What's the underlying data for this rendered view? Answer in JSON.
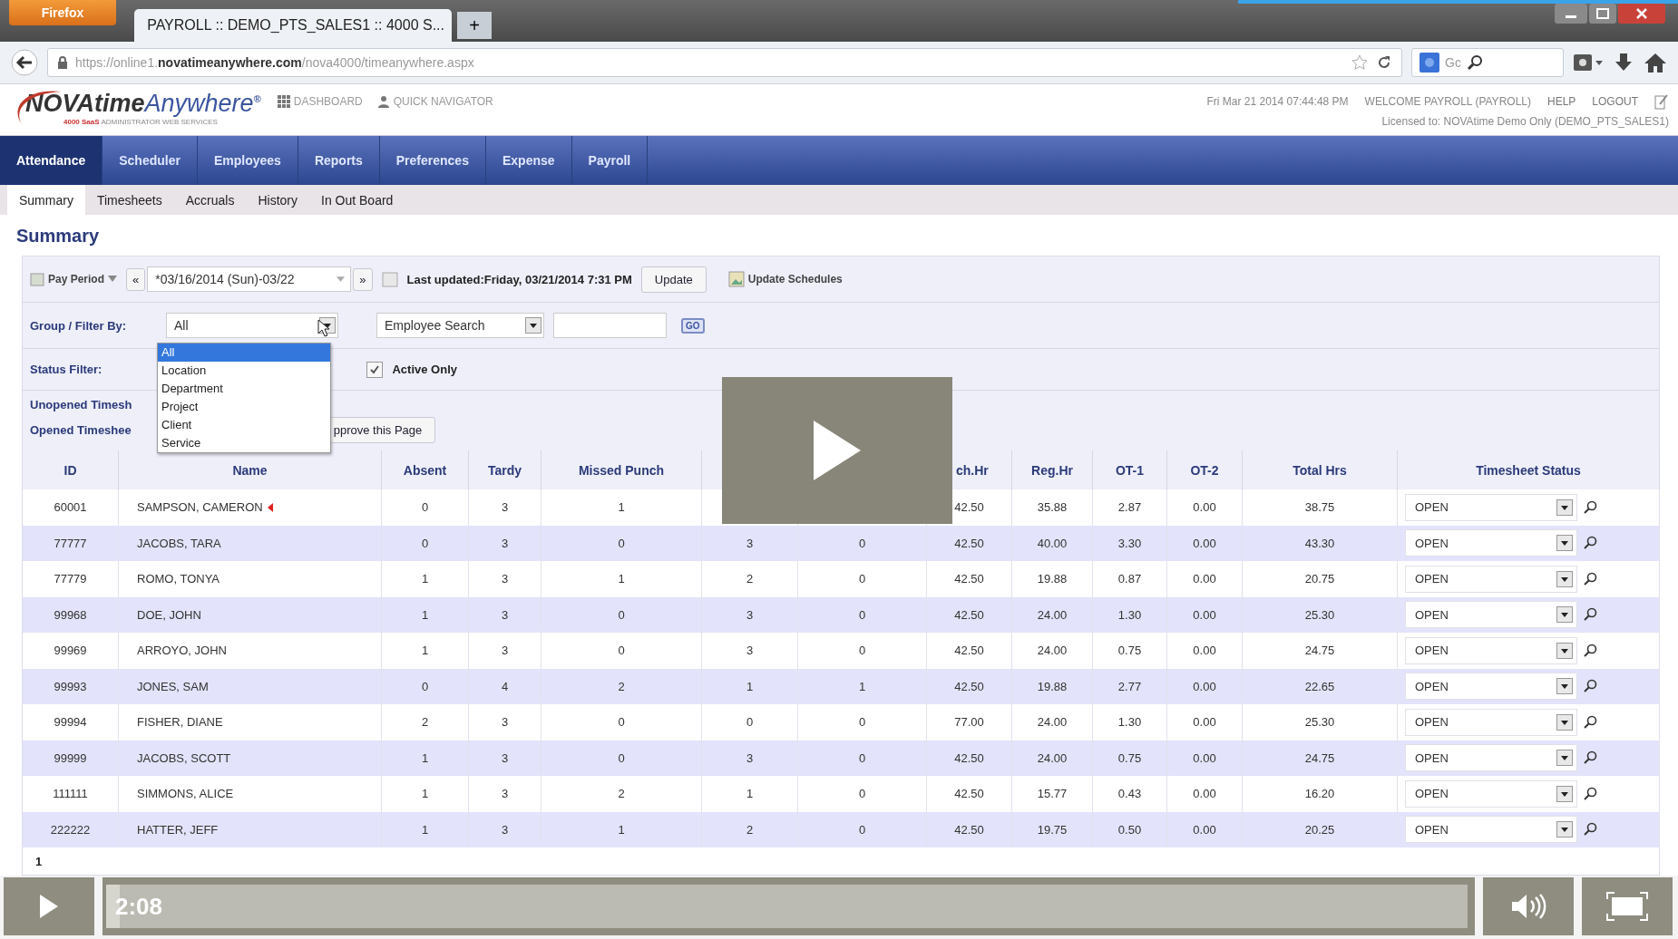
{
  "browser": {
    "menu_button": "Firefox",
    "tab_title": "PAYROLL :: DEMO_PTS_SALES1 :: 4000 S...",
    "new_tab": "+",
    "url": "https://online1.**novatimeanywhere.com**/nova4000/timeanywhere.aspx",
    "search_hint": "Gc"
  },
  "app_header": {
    "logo_main": "NOVAtime",
    "logo_accent": "Anywhere",
    "logo_mark": "®",
    "tagline_red": "4000 SaaS",
    "tagline": "ADMINISTRATOR WEB SERVICES",
    "links": [
      "DASHBOARD",
      "QUICK NAVIGATOR"
    ],
    "datetime": "Fri Mar 21 2014 07:44:48 PM",
    "welcome": "WELCOME PAYROLL (PAYROLL)",
    "help": "HELP",
    "logout": "LOGOUT",
    "license": "Licensed to: NOVAtime Demo Only (DEMO_PTS_SALES1)"
  },
  "nav": [
    {
      "label": "Attendance",
      "selected": true
    },
    {
      "label": "Scheduler",
      "selected": false
    },
    {
      "label": "Employees",
      "selected": false
    },
    {
      "label": "Reports",
      "selected": false
    },
    {
      "label": "Preferences",
      "selected": false
    },
    {
      "label": "Expense",
      "selected": false
    },
    {
      "label": "Payroll",
      "selected": false
    }
  ],
  "subnav": [
    {
      "label": "Summary",
      "selected": true
    },
    {
      "label": "Timesheets",
      "selected": false
    },
    {
      "label": "Accruals",
      "selected": false
    },
    {
      "label": "History",
      "selected": false
    },
    {
      "label": "In Out Board",
      "selected": false
    }
  ],
  "page_title": "Summary",
  "toolbar": {
    "pay_period": "Pay Period",
    "prev": "«",
    "period_value": "*03/16/2014 (Sun)-03/22",
    "next": "»",
    "last_updated": "Last updated:Friday, 03/21/2014 7:31 PM",
    "update": "Update",
    "update_schedules": "Update Schedules"
  },
  "filters": {
    "group_label": "Group / Filter By:",
    "group_value": "All",
    "search_type": "Employee Search",
    "go": "GO",
    "status_label": "Status Filter:",
    "active_only": {
      "label": "Active Only",
      "checked": true
    },
    "unopened_label": "Unopened Timesh",
    "opened_label": "Opened Timeshee",
    "approve": "pprove this Page"
  },
  "dropdown": {
    "options": [
      {
        "label": "All",
        "selected": true
      },
      {
        "label": "Location",
        "selected": false
      },
      {
        "label": "Department",
        "selected": false
      },
      {
        "label": "Project",
        "selected": false
      },
      {
        "label": "Client",
        "selected": false
      },
      {
        "label": "Service",
        "selected": false
      }
    ]
  },
  "table": {
    "columns": [
      "ID",
      "Name",
      "Absent",
      "Tardy",
      "Missed Punch",
      null,
      null,
      "ch.Hr",
      "Reg.Hr",
      "OT-1",
      "OT-2",
      "Total Hrs",
      "Timesheet Status"
    ],
    "rows": [
      {
        "cells": [
          "60001",
          "SAMPSON, CAMERON",
          "0",
          "3",
          "1",
          null,
          null,
          "42.50",
          "35.88",
          "2.87",
          "0.00",
          "38.75"
        ],
        "flagged": true,
        "status": "OPEN"
      },
      {
        "cells": [
          "77777",
          "JACOBS, TARA",
          "0",
          "3",
          "0",
          "3",
          "0",
          "42.50",
          "40.00",
          "3.30",
          "0.00",
          "43.30"
        ],
        "flagged": false,
        "status": "OPEN"
      },
      {
        "cells": [
          "77779",
          "ROMO, TONYA",
          "1",
          "3",
          "1",
          "2",
          "0",
          "42.50",
          "19.88",
          "0.87",
          "0.00",
          "20.75"
        ],
        "flagged": false,
        "status": "OPEN"
      },
      {
        "cells": [
          "99968",
          "DOE, JOHN",
          "1",
          "3",
          "0",
          "3",
          "0",
          "42.50",
          "24.00",
          "1.30",
          "0.00",
          "25.30"
        ],
        "flagged": false,
        "status": "OPEN"
      },
      {
        "cells": [
          "99969",
          "ARROYO, JOHN",
          "1",
          "3",
          "0",
          "3",
          "0",
          "42.50",
          "24.00",
          "0.75",
          "0.00",
          "24.75"
        ],
        "flagged": false,
        "status": "OPEN"
      },
      {
        "cells": [
          "99993",
          "JONES, SAM",
          "0",
          "4",
          "2",
          "1",
          "1",
          "42.50",
          "19.88",
          "2.77",
          "0.00",
          "22.65"
        ],
        "flagged": false,
        "status": "OPEN"
      },
      {
        "cells": [
          "99994",
          "FISHER, DIANE",
          "2",
          "3",
          "0",
          "0",
          "0",
          "77.00",
          "24.00",
          "1.30",
          "0.00",
          "25.30"
        ],
        "flagged": false,
        "status": "OPEN"
      },
      {
        "cells": [
          "99999",
          "JACOBS, SCOTT",
          "1",
          "3",
          "0",
          "3",
          "0",
          "42.50",
          "24.00",
          "0.75",
          "0.00",
          "24.75"
        ],
        "flagged": false,
        "status": "OPEN"
      },
      {
        "cells": [
          "111111",
          "SIMMONS, ALICE",
          "1",
          "3",
          "2",
          "1",
          "0",
          "42.50",
          "15.77",
          "0.43",
          "0.00",
          "16.20"
        ],
        "flagged": false,
        "status": "OPEN"
      },
      {
        "cells": [
          "222222",
          "HATTER, JEFF",
          "1",
          "3",
          "1",
          "2",
          "0",
          "42.50",
          "19.75",
          "0.50",
          "0.00",
          "20.25"
        ],
        "flagged": false,
        "status": "OPEN"
      }
    ],
    "pager": "1"
  },
  "player": {
    "time": "2:08",
    "level": 0.01
  }
}
